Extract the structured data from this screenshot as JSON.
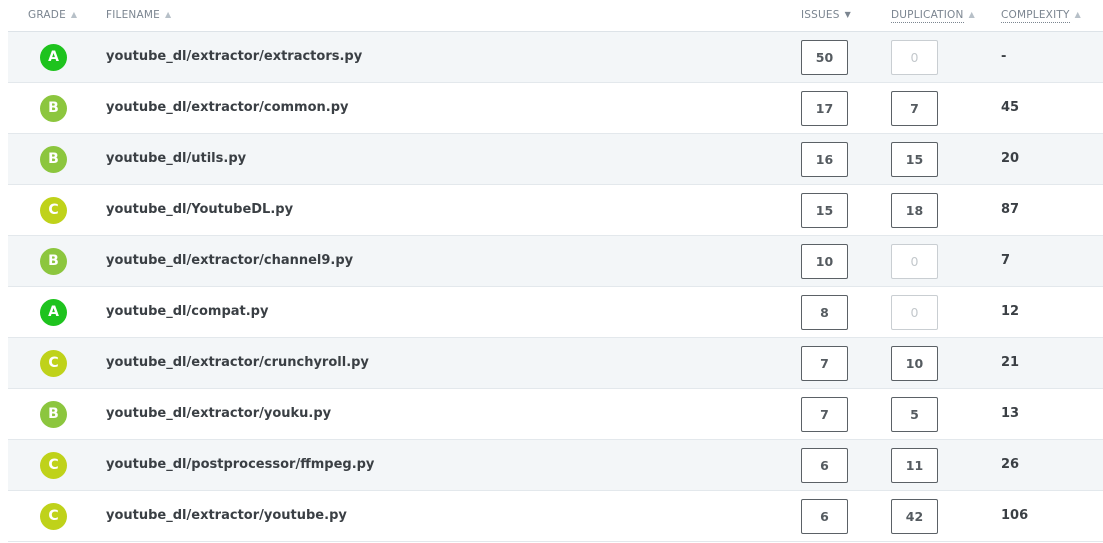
{
  "headers": {
    "grade": "GRADE",
    "filename": "FILENAME",
    "issues": "ISSUES",
    "duplication": "DUPLICATION",
    "complexity": "COMPLEXITY"
  },
  "sort_icons": {
    "asc": "▲",
    "desc": "▼"
  },
  "grade_colors": {
    "A": "#1ec31e",
    "B": "#8cc63e",
    "C": "#bfd21a"
  },
  "rows": [
    {
      "grade": "A",
      "filename": "youtube_dl/extractor/extractors.py",
      "issues": "50",
      "duplication": "0",
      "complexity": "-"
    },
    {
      "grade": "B",
      "filename": "youtube_dl/extractor/common.py",
      "issues": "17",
      "duplication": "7",
      "complexity": "45"
    },
    {
      "grade": "B",
      "filename": "youtube_dl/utils.py",
      "issues": "16",
      "duplication": "15",
      "complexity": "20"
    },
    {
      "grade": "C",
      "filename": "youtube_dl/YoutubeDL.py",
      "issues": "15",
      "duplication": "18",
      "complexity": "87"
    },
    {
      "grade": "B",
      "filename": "youtube_dl/extractor/channel9.py",
      "issues": "10",
      "duplication": "0",
      "complexity": "7"
    },
    {
      "grade": "A",
      "filename": "youtube_dl/compat.py",
      "issues": "8",
      "duplication": "0",
      "complexity": "12"
    },
    {
      "grade": "C",
      "filename": "youtube_dl/extractor/crunchyroll.py",
      "issues": "7",
      "duplication": "10",
      "complexity": "21"
    },
    {
      "grade": "B",
      "filename": "youtube_dl/extractor/youku.py",
      "issues": "7",
      "duplication": "5",
      "complexity": "13"
    },
    {
      "grade": "C",
      "filename": "youtube_dl/postprocessor/ffmpeg.py",
      "issues": "6",
      "duplication": "11",
      "complexity": "26"
    },
    {
      "grade": "C",
      "filename": "youtube_dl/extractor/youtube.py",
      "issues": "6",
      "duplication": "42",
      "complexity": "106"
    }
  ]
}
